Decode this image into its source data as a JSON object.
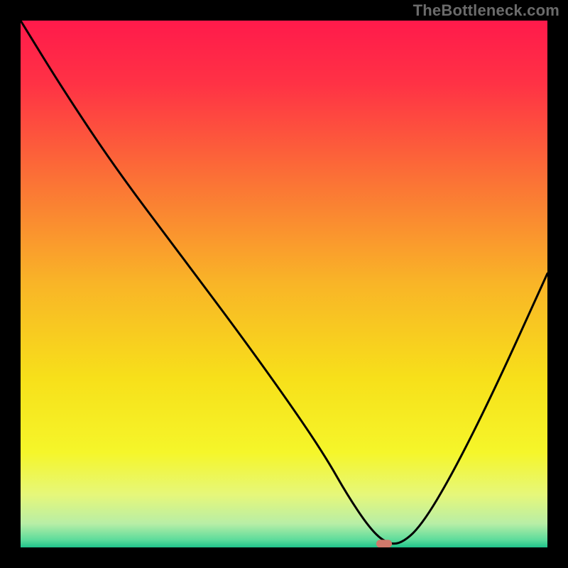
{
  "watermark": "TheBottleneck.com",
  "chart_data": {
    "type": "line",
    "title": "",
    "xlabel": "",
    "ylabel": "",
    "xlim": [
      0,
      100
    ],
    "ylim": [
      0,
      100
    ],
    "grid": false,
    "legend": false,
    "background_gradient": {
      "stops": [
        {
          "offset": 0.0,
          "color": "#ff1a4b"
        },
        {
          "offset": 0.12,
          "color": "#ff3245"
        },
        {
          "offset": 0.3,
          "color": "#fb7136"
        },
        {
          "offset": 0.5,
          "color": "#f9b527"
        },
        {
          "offset": 0.68,
          "color": "#f7e01a"
        },
        {
          "offset": 0.82,
          "color": "#f5f62a"
        },
        {
          "offset": 0.9,
          "color": "#e6f77a"
        },
        {
          "offset": 0.955,
          "color": "#b8eea6"
        },
        {
          "offset": 0.985,
          "color": "#5fdc9c"
        },
        {
          "offset": 1.0,
          "color": "#20c38b"
        }
      ]
    },
    "series": [
      {
        "name": "curve",
        "x": [
          0,
          8,
          18,
          30,
          42,
          52,
          58,
          62,
          66,
          69,
          72,
          76,
          82,
          90,
          100
        ],
        "y": [
          100,
          87,
          72,
          56,
          40,
          26,
          17,
          10,
          4,
          1,
          0.5,
          4,
          14,
          30,
          52
        ]
      }
    ],
    "marker": {
      "x": 69,
      "y": 0.7,
      "width": 3,
      "height": 1.5,
      "color": "#d0796b"
    }
  }
}
